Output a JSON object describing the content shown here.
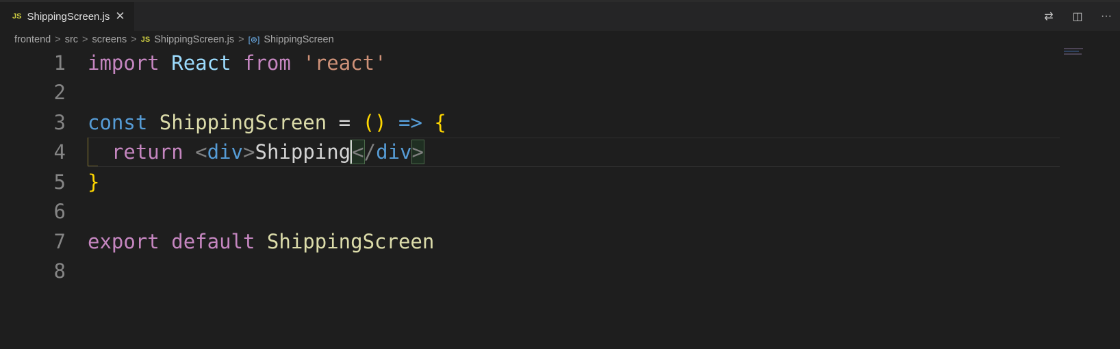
{
  "tab": {
    "icon": "JS",
    "title": "ShippingScreen.js",
    "close": "✕"
  },
  "actions": [
    {
      "name": "open-changes-icon",
      "glyph": "⇄"
    },
    {
      "name": "split-editor-icon",
      "glyph": "◫"
    },
    {
      "name": "more-actions-icon",
      "glyph": "···"
    }
  ],
  "breadcrumb": {
    "items": [
      "frontend",
      "src",
      "screens"
    ],
    "file_icon": "JS",
    "file": "ShippingScreen.js",
    "symbol_icon": "[⊚]",
    "symbol": "ShippingScreen",
    "separator": ">"
  },
  "editor": {
    "lines": [
      {
        "n": "1",
        "tokens": [
          [
            "kw",
            "import"
          ],
          [
            "op",
            " "
          ],
          [
            "var",
            "React"
          ],
          [
            "op",
            " "
          ],
          [
            "kw",
            "from"
          ],
          [
            "op",
            " "
          ],
          [
            "str",
            "'react'"
          ]
        ]
      },
      {
        "n": "2",
        "tokens": []
      },
      {
        "n": "3",
        "tokens": [
          [
            "decl",
            "const"
          ],
          [
            "op",
            " "
          ],
          [
            "fn",
            "ShippingScreen"
          ],
          [
            "op",
            " = "
          ],
          [
            "paren",
            "()"
          ],
          [
            "op",
            " "
          ],
          [
            "decl",
            "=>"
          ],
          [
            "op",
            " "
          ],
          [
            "paren",
            "{"
          ]
        ]
      },
      {
        "n": "4",
        "tokens": [
          [
            "op",
            "  "
          ],
          [
            "kw",
            "return"
          ],
          [
            "op",
            " "
          ],
          [
            "punc",
            "<"
          ],
          [
            "tag",
            "div"
          ],
          [
            "punc",
            ">"
          ],
          [
            "txt",
            "Shipping"
          ],
          [
            "punc bm caret",
            "<"
          ],
          [
            "punc",
            "/"
          ],
          [
            "tag",
            "div"
          ],
          [
            "punc bm",
            ">"
          ]
        ]
      },
      {
        "n": "5",
        "tokens": [
          [
            "paren",
            "}"
          ]
        ]
      },
      {
        "n": "6",
        "tokens": []
      },
      {
        "n": "7",
        "tokens": [
          [
            "kw",
            "export"
          ],
          [
            "op",
            " "
          ],
          [
            "kw",
            "default"
          ],
          [
            "op",
            " "
          ],
          [
            "fn",
            "ShippingScreen"
          ]
        ]
      },
      {
        "n": "8",
        "tokens": []
      }
    ],
    "current_line": "4"
  }
}
